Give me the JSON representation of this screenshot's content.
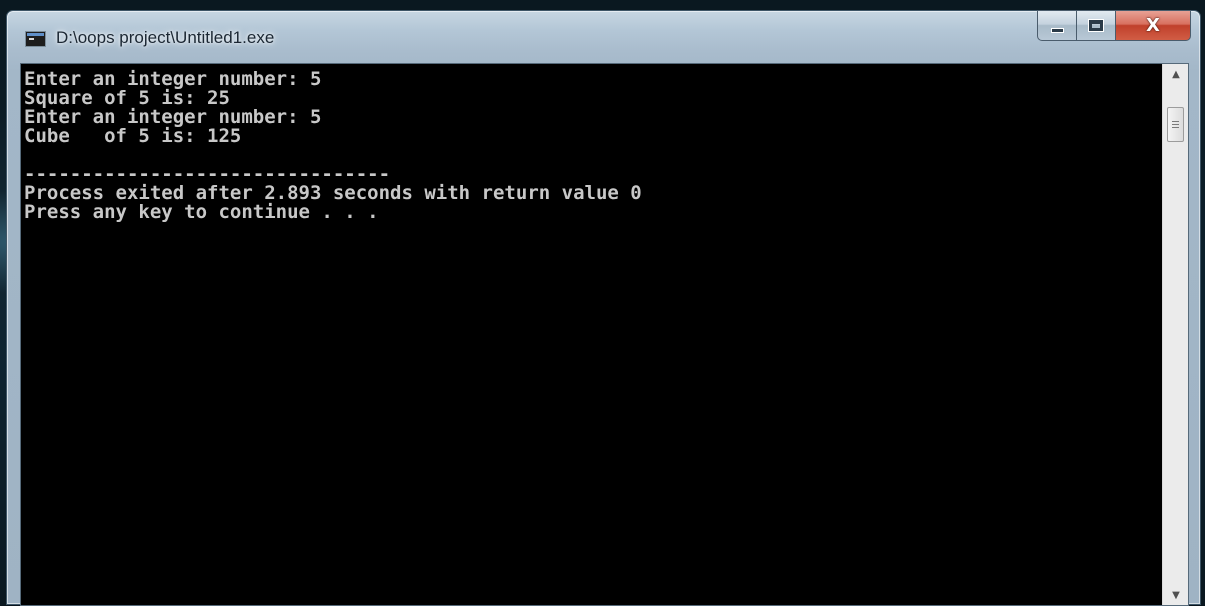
{
  "window": {
    "title": "D:\\oops project\\Untitled1.exe",
    "close_label": "X"
  },
  "console": {
    "lines": [
      "Enter an integer number: 5",
      "Square of 5 is: 25",
      "Enter an integer number: 5",
      "Cube   of 5 is: 125",
      "",
      "--------------------------------",
      "Process exited after 2.893 seconds with return value 0",
      "Press any key to continue . . ."
    ]
  },
  "colors": {
    "console_background": "#000000",
    "console_text": "#c8c8c8",
    "close_button": "#c7432e"
  },
  "icons": {
    "app": "console-app-icon",
    "minimize": "minimize-icon",
    "maximize": "maximize-icon",
    "close": "close-icon",
    "scroll_up": "scroll-up-arrow-icon",
    "scroll_down": "scroll-down-arrow-icon"
  }
}
